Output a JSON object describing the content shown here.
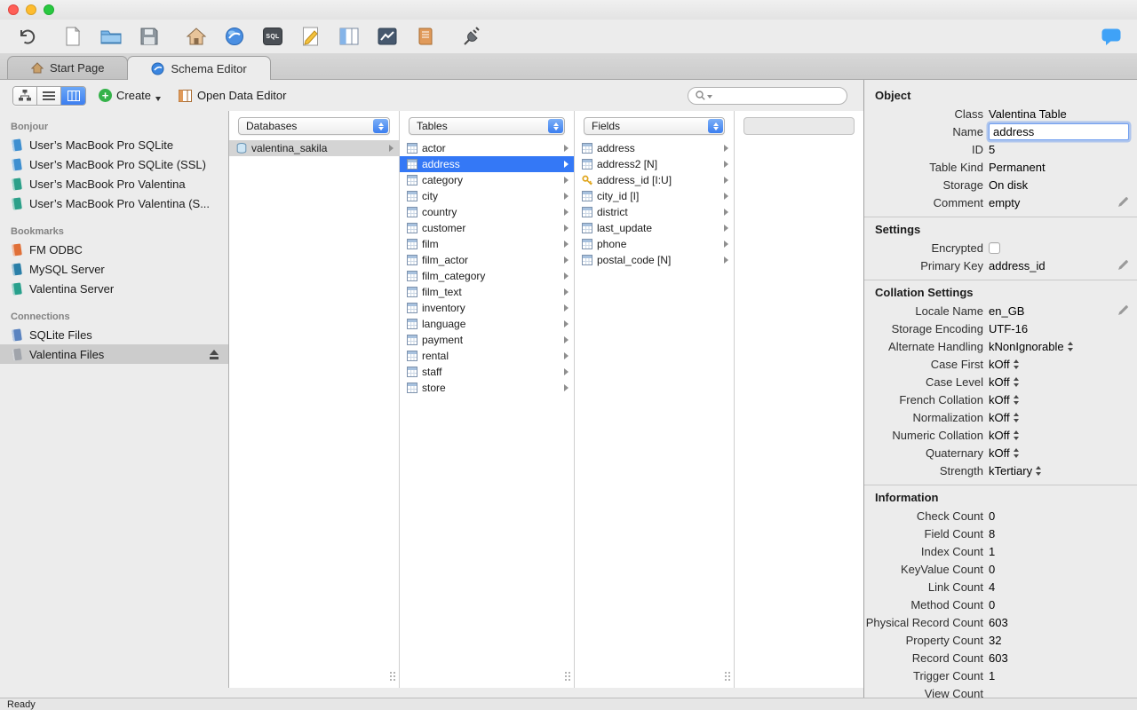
{
  "status": {
    "text": "Ready"
  },
  "toolbar": {
    "sql_label": "SQL",
    "icons": [
      "undo",
      "new-document",
      "open-folder",
      "save",
      "start-page",
      "schema-editor",
      "sql-editor",
      "query-builder",
      "data-editor",
      "chart",
      "report",
      "connect",
      "feedback"
    ]
  },
  "tab_bar": {
    "tabs": [
      {
        "label": "Start Page",
        "active": false
      },
      {
        "label": "Schema Editor",
        "active": true
      }
    ]
  },
  "editor_toolbar": {
    "view_modes": [
      "tree",
      "list",
      "columns"
    ],
    "active_view": "columns",
    "create_label": "Create",
    "open_data_editor_label": "Open Data Editor",
    "search_placeholder": ""
  },
  "sidebar": {
    "sections": [
      {
        "title": "Bonjour",
        "items": [
          {
            "label": "User’s MacBook Pro SQLite",
            "icon": "sqlite-service"
          },
          {
            "label": "User’s MacBook Pro SQLite (SSL)",
            "icon": "sqlite-service"
          },
          {
            "label": "User’s MacBook Pro Valentina",
            "icon": "valentina-service"
          },
          {
            "label": "User’s MacBook Pro Valentina (S...",
            "icon": "valentina-service"
          }
        ]
      },
      {
        "title": "Bookmarks",
        "items": [
          {
            "label": "FM ODBC",
            "icon": "fm-odbc"
          },
          {
            "label": "MySQL Server",
            "icon": "mysql-server"
          },
          {
            "label": "Valentina Server",
            "icon": "valentina-server"
          }
        ]
      },
      {
        "title": "Connections",
        "items": [
          {
            "label": "SQLite Files",
            "icon": "sqlite-files"
          },
          {
            "label": "Valentina Files",
            "icon": "valentina-files",
            "selected": true,
            "eject": true
          }
        ]
      }
    ]
  },
  "browser": {
    "columns": [
      {
        "picker": "Databases",
        "items": [
          {
            "label": "valentina_sakila",
            "icon": "database",
            "selected": "inactive",
            "arrow": true
          }
        ]
      },
      {
        "picker": "Tables",
        "items": [
          {
            "label": "actor",
            "icon": "table",
            "arrow": true
          },
          {
            "label": "address",
            "icon": "table",
            "arrow": true,
            "selected": "active"
          },
          {
            "label": "category",
            "icon": "table",
            "arrow": true
          },
          {
            "label": "city",
            "icon": "table",
            "arrow": true
          },
          {
            "label": "country",
            "icon": "table",
            "arrow": true
          },
          {
            "label": "customer",
            "icon": "table",
            "arrow": true
          },
          {
            "label": "film",
            "icon": "table",
            "arrow": true
          },
          {
            "label": "film_actor",
            "icon": "table",
            "arrow": true
          },
          {
            "label": "film_category",
            "icon": "table",
            "arrow": true
          },
          {
            "label": "film_text",
            "icon": "table",
            "arrow": true
          },
          {
            "label": "inventory",
            "icon": "table",
            "arrow": true
          },
          {
            "label": "language",
            "icon": "table",
            "arrow": true
          },
          {
            "label": "payment",
            "icon": "table",
            "arrow": true
          },
          {
            "label": "rental",
            "icon": "table",
            "arrow": true
          },
          {
            "label": "staff",
            "icon": "table",
            "arrow": true
          },
          {
            "label": "store",
            "icon": "table",
            "arrow": true
          }
        ]
      },
      {
        "picker": "Fields",
        "items": [
          {
            "label": "address",
            "icon": "field",
            "arrow": true
          },
          {
            "label": "address2 [N]",
            "icon": "field",
            "arrow": true
          },
          {
            "label": "address_id [I:U]",
            "icon": "key",
            "arrow": true
          },
          {
            "label": "city_id [I]",
            "icon": "field",
            "arrow": true
          },
          {
            "label": "district",
            "icon": "field",
            "arrow": true
          },
          {
            "label": "last_update",
            "icon": "field",
            "arrow": true
          },
          {
            "label": "phone",
            "icon": "field",
            "arrow": true
          },
          {
            "label": "postal_code [N]",
            "icon": "field",
            "arrow": true
          }
        ]
      },
      {
        "picker": "",
        "items": []
      }
    ]
  },
  "inspector": {
    "sections": [
      {
        "title": "Object",
        "rows": [
          {
            "label": "Class",
            "value": "Valentina Table"
          },
          {
            "label": "Name",
            "value": "address",
            "control": "input"
          },
          {
            "label": "ID",
            "value": "5"
          },
          {
            "label": "Table Kind",
            "value": "Permanent"
          },
          {
            "label": "Storage",
            "value": "On disk"
          },
          {
            "label": "Comment",
            "value": "empty",
            "edit": true
          }
        ]
      },
      {
        "title": "Settings",
        "rows": [
          {
            "label": "Encrypted",
            "value": "",
            "control": "checkbox"
          },
          {
            "label": "Primary Key",
            "value": "address_id",
            "edit": true
          }
        ]
      },
      {
        "title": "Collation Settings",
        "rows": [
          {
            "label": "Locale Name",
            "value": "en_GB",
            "edit": true
          },
          {
            "label": "Storage Encoding",
            "value": "UTF-16"
          },
          {
            "label": "Alternate Handling",
            "value": "kNonIgnorable",
            "control": "select"
          },
          {
            "label": "Case First",
            "value": "kOff",
            "control": "select"
          },
          {
            "label": "Case Level",
            "value": "kOff",
            "control": "select"
          },
          {
            "label": "French Collation",
            "value": "kOff",
            "control": "select"
          },
          {
            "label": "Normalization",
            "value": "kOff",
            "control": "select"
          },
          {
            "label": "Numeric Collation",
            "value": "kOff",
            "control": "select"
          },
          {
            "label": "Quaternary",
            "value": "kOff",
            "control": "select"
          },
          {
            "label": "Strength",
            "value": "kTertiary",
            "control": "select"
          }
        ]
      },
      {
        "title": "Information",
        "rows": [
          {
            "label": "Check Count",
            "value": "0"
          },
          {
            "label": "Field Count",
            "value": "8"
          },
          {
            "label": "Index Count",
            "value": "1"
          },
          {
            "label": "KeyValue Count",
            "value": "0"
          },
          {
            "label": "Link Count",
            "value": "4"
          },
          {
            "label": "Method Count",
            "value": "0"
          },
          {
            "label": "Physical Record Count",
            "value": "603"
          },
          {
            "label": "Property Count",
            "value": "32"
          },
          {
            "label": "Record Count",
            "value": "603"
          },
          {
            "label": "Trigger Count",
            "value": "1"
          },
          {
            "label": "View Count",
            "value": ""
          }
        ]
      }
    ]
  },
  "colors": {
    "selection_blue": "#3478f6",
    "inactive_selection": "#d4d4d4",
    "create_green": "#35b24a",
    "stepper_blue": "#3c7ef0",
    "feedback_blue": "#3fa2f7"
  }
}
